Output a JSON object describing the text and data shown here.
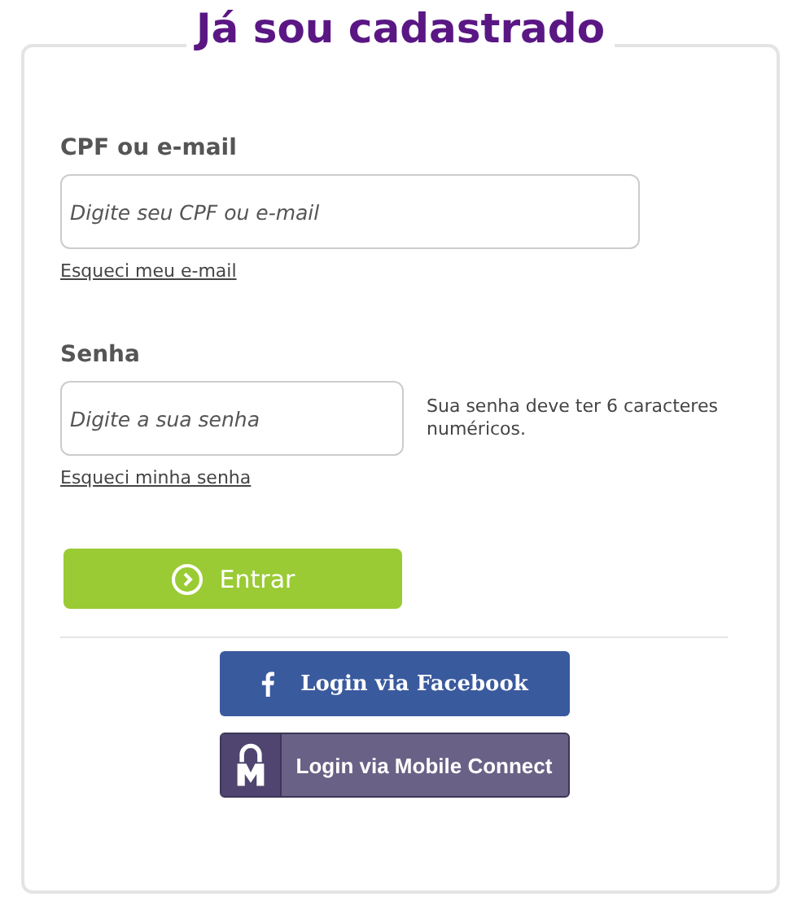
{
  "title": "Já sou cadastrado",
  "fields": [
    {
      "label": "CPF ou e-mail",
      "placeholder": "Digite seu CPF ou e-mail",
      "link": "Esqueci meu e-mail",
      "kind": "wide"
    },
    {
      "label": "Senha",
      "placeholder": "Digite a sua senha",
      "link": "Esqueci minha senha",
      "kind": "narrow",
      "hint": "Sua senha deve ter 6 caracteres numéricos."
    }
  ],
  "submit": "Entrar",
  "social": [
    {
      "kind": "facebook",
      "label": "Login via Facebook"
    },
    {
      "kind": "mobile",
      "label": "Login via Mobile Connect"
    }
  ]
}
